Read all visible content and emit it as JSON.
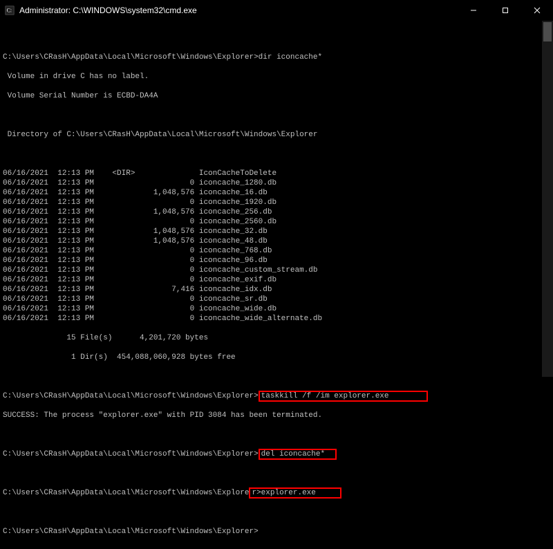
{
  "window": {
    "title": "Administrator: C:\\WINDOWS\\system32\\cmd.exe"
  },
  "prompt_path": "C:\\Users\\CRasH\\AppData\\Local\\Microsoft\\Windows\\Explorer",
  "cmd1": "dir iconcache*",
  "vol_line1": " Volume in drive C has no label.",
  "vol_line2": " Volume Serial Number is ECBD-DA4A",
  "dir_of": " Directory of C:\\Users\\CRasH\\AppData\\Local\\Microsoft\\Windows\\Explorer",
  "listing": [
    {
      "date": "06/16/2021",
      "time": "12:13 PM",
      "dir": "<DIR>",
      "size": "",
      "name": "IconCacheToDelete"
    },
    {
      "date": "06/16/2021",
      "time": "12:13 PM",
      "dir": "",
      "size": "0",
      "name": "iconcache_1280.db"
    },
    {
      "date": "06/16/2021",
      "time": "12:13 PM",
      "dir": "",
      "size": "1,048,576",
      "name": "iconcache_16.db"
    },
    {
      "date": "06/16/2021",
      "time": "12:13 PM",
      "dir": "",
      "size": "0",
      "name": "iconcache_1920.db"
    },
    {
      "date": "06/16/2021",
      "time": "12:13 PM",
      "dir": "",
      "size": "1,048,576",
      "name": "iconcache_256.db"
    },
    {
      "date": "06/16/2021",
      "time": "12:13 PM",
      "dir": "",
      "size": "0",
      "name": "iconcache_2560.db"
    },
    {
      "date": "06/16/2021",
      "time": "12:13 PM",
      "dir": "",
      "size": "1,048,576",
      "name": "iconcache_32.db"
    },
    {
      "date": "06/16/2021",
      "time": "12:13 PM",
      "dir": "",
      "size": "1,048,576",
      "name": "iconcache_48.db"
    },
    {
      "date": "06/16/2021",
      "time": "12:13 PM",
      "dir": "",
      "size": "0",
      "name": "iconcache_768.db"
    },
    {
      "date": "06/16/2021",
      "time": "12:13 PM",
      "dir": "",
      "size": "0",
      "name": "iconcache_96.db"
    },
    {
      "date": "06/16/2021",
      "time": "12:13 PM",
      "dir": "",
      "size": "0",
      "name": "iconcache_custom_stream.db"
    },
    {
      "date": "06/16/2021",
      "time": "12:13 PM",
      "dir": "",
      "size": "0",
      "name": "iconcache_exif.db"
    },
    {
      "date": "06/16/2021",
      "time": "12:13 PM",
      "dir": "",
      "size": "7,416",
      "name": "iconcache_idx.db"
    },
    {
      "date": "06/16/2021",
      "time": "12:13 PM",
      "dir": "",
      "size": "0",
      "name": "iconcache_sr.db"
    },
    {
      "date": "06/16/2021",
      "time": "12:13 PM",
      "dir": "",
      "size": "0",
      "name": "iconcache_wide.db"
    },
    {
      "date": "06/16/2021",
      "time": "12:13 PM",
      "dir": "",
      "size": "0",
      "name": "iconcache_wide_alternate.db"
    }
  ],
  "summary1": "              15 File(s)      4,201,720 bytes",
  "summary2": "               1 Dir(s)  454,088,060,928 bytes free",
  "cmd2": "taskkill /f /im explorer.exe",
  "success_line": "SUCCESS: The process \"explorer.exe\" with PID 3084 has been terminated.",
  "cmd3": "del iconcache*",
  "cmd4_prompt_prefix": "C:\\Users\\CRasH\\AppData\\Local\\Microsoft\\Windows\\Explore",
  "cmd4_hl": "r>explorer.exe",
  "final_prompt_suffix": ">"
}
